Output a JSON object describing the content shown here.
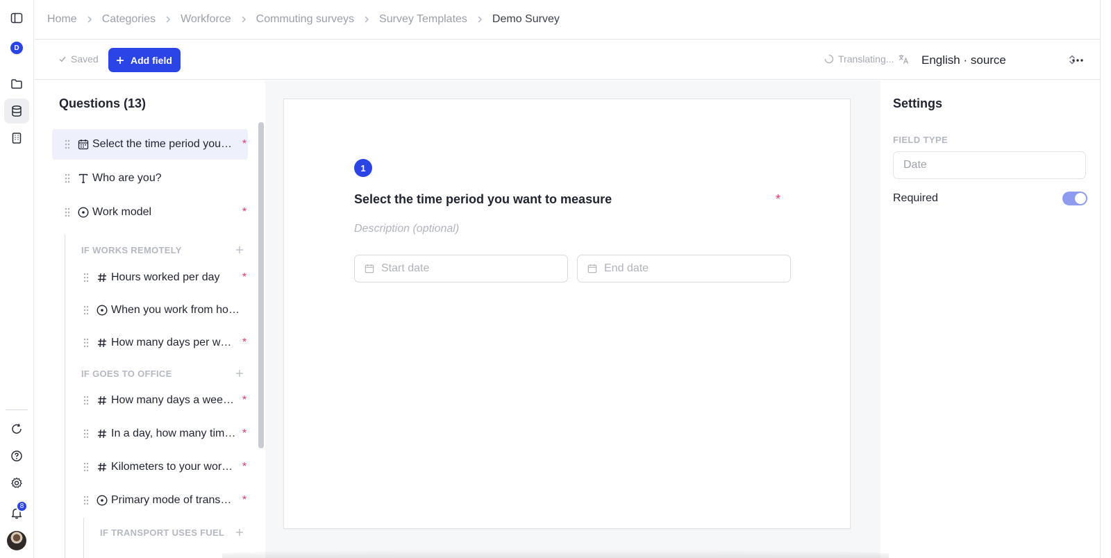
{
  "breadcrumb": {
    "items": [
      "Home",
      "Categories",
      "Workforce",
      "Commuting surveys",
      "Survey Templates",
      "Demo Survey"
    ]
  },
  "rail": {
    "logo_letter": "D",
    "notification_count": "8",
    "icons": [
      "sidebar-toggle-icon",
      "app-logo",
      "folder-icon",
      "database-icon",
      "building-icon",
      "refresh-icon",
      "help-icon",
      "gear-icon",
      "bell-icon",
      "avatar"
    ]
  },
  "toolbar": {
    "saved_label": "Saved",
    "add_field_label": "Add field",
    "translating_label": "Translating...",
    "language_value": "English · source"
  },
  "questions": {
    "title": "Questions (13)",
    "items": [
      {
        "label": "Select the time period you…",
        "icon": "calendar-icon",
        "required": "*"
      },
      {
        "label": "Who are you?",
        "icon": "text-icon",
        "required": ""
      },
      {
        "label": "Work model",
        "icon": "radio-icon",
        "required": "*"
      },
      {
        "label": "Hours worked per day",
        "icon": "hash-icon",
        "required": "*"
      },
      {
        "label": "When you work from ho…",
        "icon": "radio-icon",
        "required": ""
      },
      {
        "label": "How many days per w…",
        "icon": "hash-icon",
        "required": "*"
      },
      {
        "label": "How many days a wee…",
        "icon": "hash-icon",
        "required": "*"
      },
      {
        "label": "In a day, how many tim…",
        "icon": "hash-icon",
        "required": "*"
      },
      {
        "label": "Kilometers to your wor…",
        "icon": "hash-icon",
        "required": "*"
      },
      {
        "label": "Primary mode of trans…",
        "icon": "radio-icon",
        "required": "*"
      }
    ],
    "groups": [
      "IF WORKS REMOTELY",
      "IF GOES TO OFFICE",
      "IF TRANSPORT USES FUEL"
    ]
  },
  "editor": {
    "number": "1",
    "heading": "Select the time period you want to measure",
    "required_mark": "*",
    "description_placeholder": "Description (optional)",
    "start_placeholder": "Start date",
    "end_placeholder": "End date"
  },
  "settings": {
    "title": "Settings",
    "field_type_label": "FIELD TYPE",
    "field_type_value": "Date",
    "required_label": "Required",
    "required_on": true
  },
  "colors": {
    "accent": "#2b44e6",
    "required": "#e8356b",
    "toggle_on": "#8e9cf0"
  }
}
